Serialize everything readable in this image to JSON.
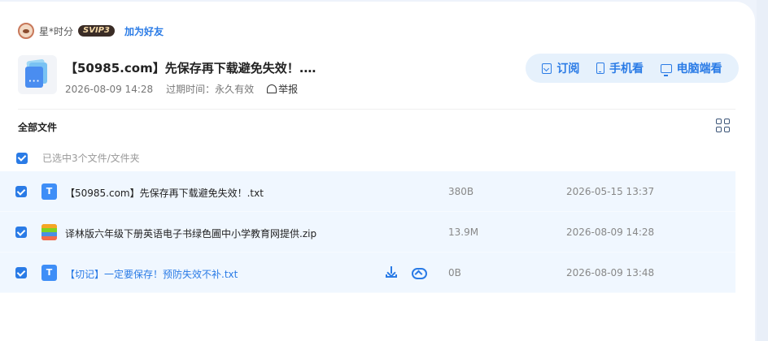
{
  "sharer": {
    "name": "星*时分",
    "badge": "SVIP3",
    "add_friend": "加为好友"
  },
  "share": {
    "title": "【50985.com】先保存再下载避免失效！.…",
    "date": "2026-08-09 14:28",
    "expire": "过期时间：永久有效",
    "report": "举报"
  },
  "actions": {
    "subscribe": "订阅",
    "mobile": "手机看",
    "pc": "电脑端看"
  },
  "section": {
    "title": "全部文件",
    "selected_text": "已选中3个文件/文件夹"
  },
  "files": [
    {
      "name": "【50985.com】先保存再下载避免失效！.txt",
      "size": "380B",
      "date": "2026-05-15 13:37",
      "icon": "txt-file-icon",
      "icon_label": "T"
    },
    {
      "name": "译林版六年级下册英语电子书绿色圃中小学教育网提供.zip",
      "size": "13.9M",
      "date": "2026-08-09 14:28",
      "icon": "zip-file-icon"
    },
    {
      "name": "【切记】一定要保存！预防失效不补.txt",
      "size": "0B",
      "date": "2026-08-09 13:48",
      "icon": "txt-file-icon",
      "icon_label": "T"
    }
  ],
  "colors": {
    "accent": "#2a7be6",
    "row_selected_bg": "#f0f7ff",
    "page_bg": "#eef3fb"
  }
}
